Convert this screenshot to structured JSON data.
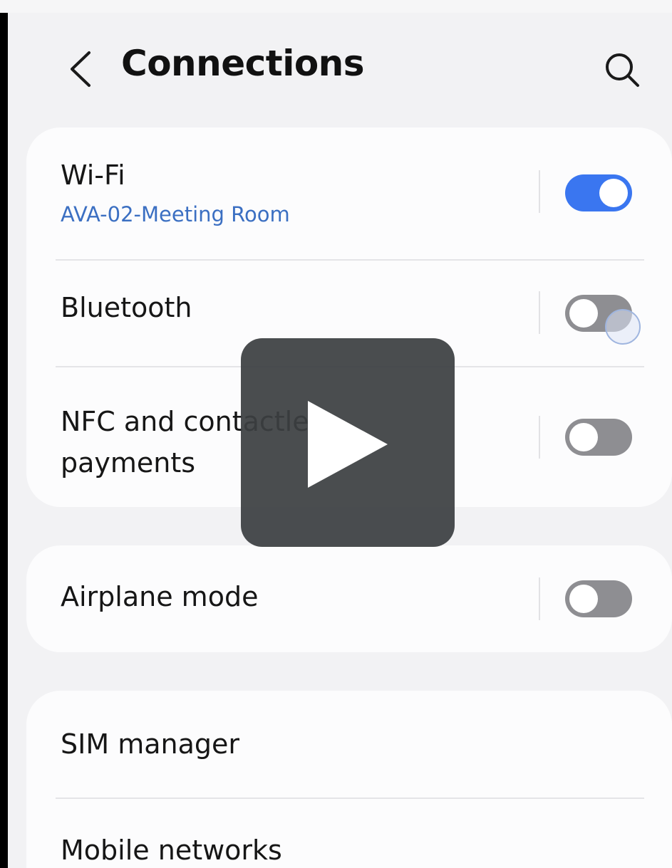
{
  "header": {
    "title": "Connections",
    "back_icon": "chevron-left-icon",
    "search_icon": "search-icon"
  },
  "group_1": {
    "wifi": {
      "label": "Wi-Fi",
      "network": "AVA-02-Meeting Room",
      "enabled": true
    },
    "bluetooth": {
      "label": "Bluetooth",
      "enabled": false
    },
    "nfc": {
      "label_line1": "NFC and contactless",
      "label_line2": "payments",
      "enabled": false
    }
  },
  "group_2": {
    "airplane": {
      "label": "Airplane mode",
      "enabled": false
    }
  },
  "group_3": {
    "sim": {
      "label": "SIM manager"
    },
    "mobile": {
      "label": "Mobile networks"
    }
  },
  "overlay": {
    "icon": "play-icon"
  },
  "colors": {
    "accent": "#3a76f0",
    "subtext": "#3b6fc2",
    "toggle_off": "#8e8e92",
    "background": "#f2f2f4",
    "card": "#fcfcfd"
  }
}
